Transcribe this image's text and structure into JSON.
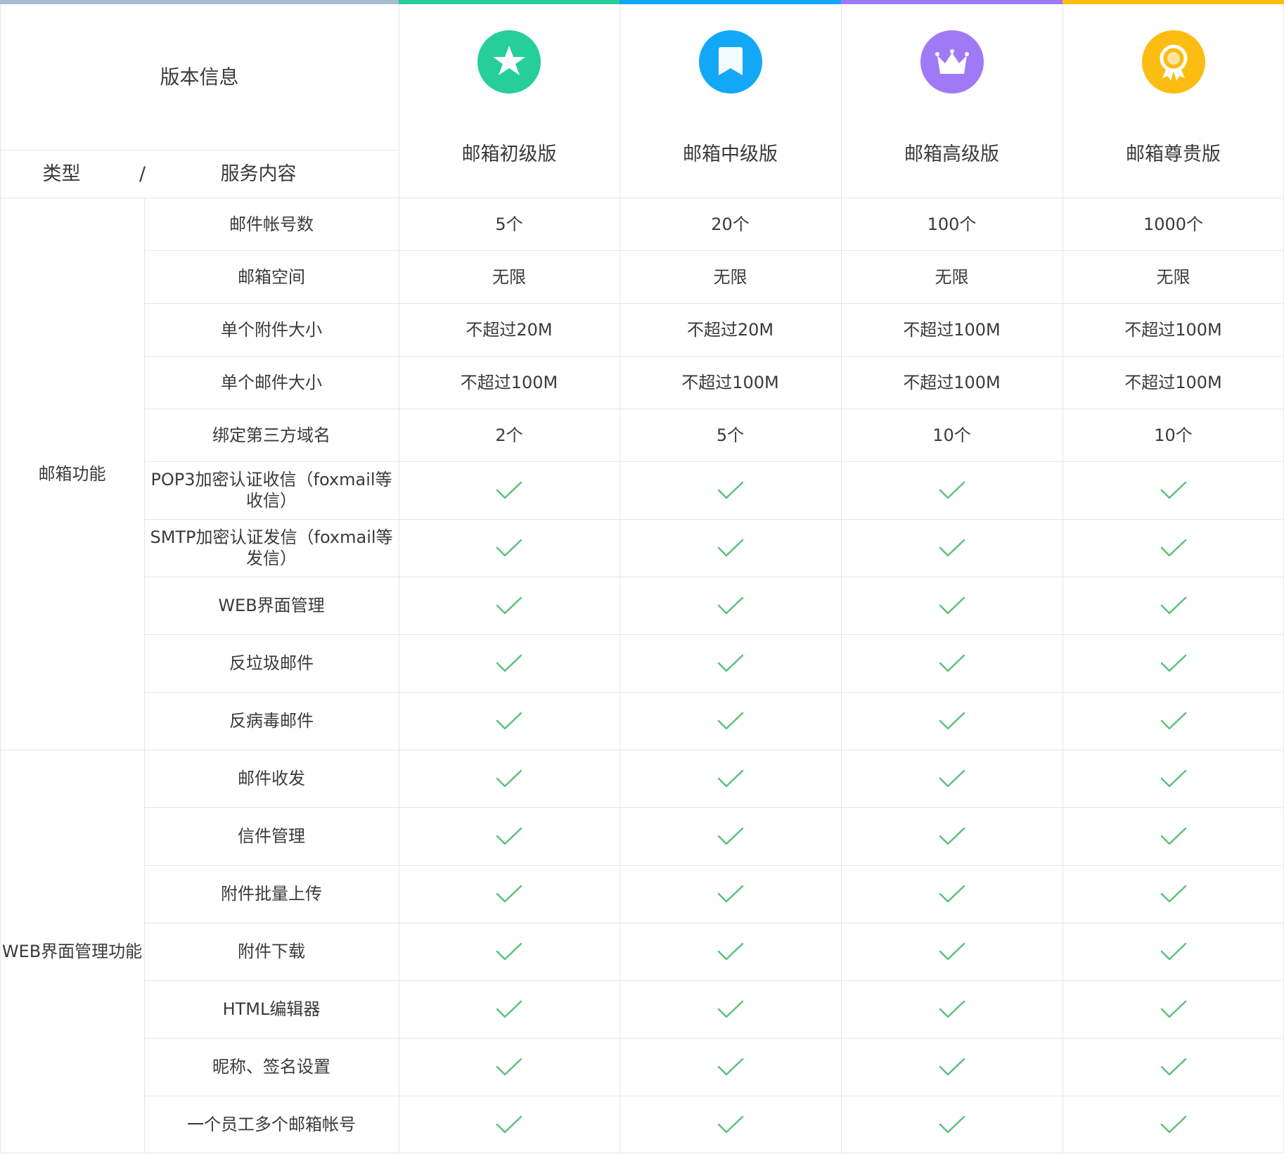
{
  "header": {
    "version_info": "版本信息",
    "type_label": "类型",
    "slash": "/",
    "service_label": "服务内容"
  },
  "plans": [
    {
      "name": "邮箱初级版",
      "color": "#26cf9a",
      "icon": "star-icon"
    },
    {
      "name": "邮箱中级版",
      "color": "#13a8f7",
      "icon": "bookmark-icon"
    },
    {
      "name": "邮箱高级版",
      "color": "#a07af6",
      "icon": "crown-icon"
    },
    {
      "name": "邮箱尊贵版",
      "color": "#fbbd12",
      "icon": "medal-icon"
    }
  ],
  "groups": [
    {
      "label": "邮箱功能",
      "rows": 10
    },
    {
      "label": "WEB界面管理功能",
      "rows": 7
    }
  ],
  "rows": [
    {
      "label": "邮件帐号数",
      "values": [
        "5个",
        "20个",
        "100个",
        "1000个"
      ]
    },
    {
      "label": "邮箱空间",
      "values": [
        "无限",
        "无限",
        "无限",
        "无限"
      ]
    },
    {
      "label": "单个附件大小",
      "values": [
        "不超过20M",
        "不超过20M",
        "不超过100M",
        "不超过100M"
      ]
    },
    {
      "label": "单个邮件大小",
      "values": [
        "不超过100M",
        "不超过100M",
        "不超过100M",
        "不超过100M"
      ]
    },
    {
      "label": "绑定第三方域名",
      "values": [
        "2个",
        "5个",
        "10个",
        "10个"
      ]
    },
    {
      "label": "POP3加密认证收信（foxmail等\n收信）",
      "values": [
        "check",
        "check",
        "check",
        "check"
      ]
    },
    {
      "label": "SMTP加密认证发信（foxmail等\n发信）",
      "values": [
        "check",
        "check",
        "check",
        "check"
      ]
    },
    {
      "label": "WEB界面管理",
      "values": [
        "check",
        "check",
        "check",
        "check"
      ]
    },
    {
      "label": "反垃圾邮件",
      "values": [
        "check",
        "check",
        "check",
        "check"
      ]
    },
    {
      "label": "反病毒邮件",
      "values": [
        "check",
        "check",
        "check",
        "check"
      ]
    },
    {
      "label": "邮件收发",
      "values": [
        "check",
        "check",
        "check",
        "check"
      ]
    },
    {
      "label": "信件管理",
      "values": [
        "check",
        "check",
        "check",
        "check"
      ]
    },
    {
      "label": "附件批量上传",
      "values": [
        "check",
        "check",
        "check",
        "check"
      ]
    },
    {
      "label": "附件下载",
      "values": [
        "check",
        "check",
        "check",
        "check"
      ]
    },
    {
      "label": "HTML编辑器",
      "values": [
        "check",
        "check",
        "check",
        "check"
      ]
    },
    {
      "label": "昵称、签名设置",
      "values": [
        "check",
        "check",
        "check",
        "check"
      ]
    },
    {
      "label": "一个员工多个邮箱帐号",
      "values": [
        "check",
        "check",
        "check",
        "check"
      ]
    }
  ],
  "colors": {
    "check": "#5cc27a",
    "grid": "#e6e6e6",
    "left_bar": "#a8bcd4"
  }
}
